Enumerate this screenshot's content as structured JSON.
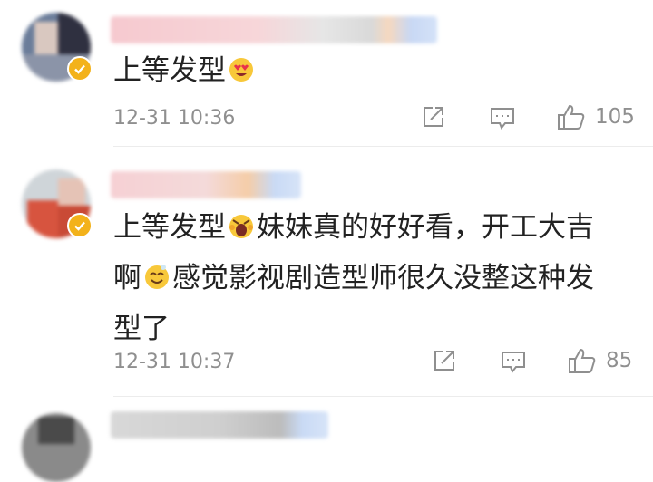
{
  "comments": [
    {
      "text": "上等发型",
      "time": "12-31 10:36",
      "likes": "105",
      "emoji": "heart-eyes"
    },
    {
      "text_line1a": "上等发型",
      "text_line1b": "妹妹真的好好看，开工大吉",
      "text_line2a": "啊",
      "text_line2b": "感觉影视剧造型师很久没整这种发",
      "text_line3": "型了",
      "time": "12-31 10:37",
      "likes": "85",
      "emoji": [
        "screaming",
        "smile"
      ]
    },
    {
      "name_blurred": true
    }
  ],
  "colors": {
    "badge": "#f3b21b",
    "meta": "#8f8f8f"
  },
  "icons": [
    "share-icon",
    "comment-icon",
    "like-icon",
    "verified-badge-icon"
  ]
}
